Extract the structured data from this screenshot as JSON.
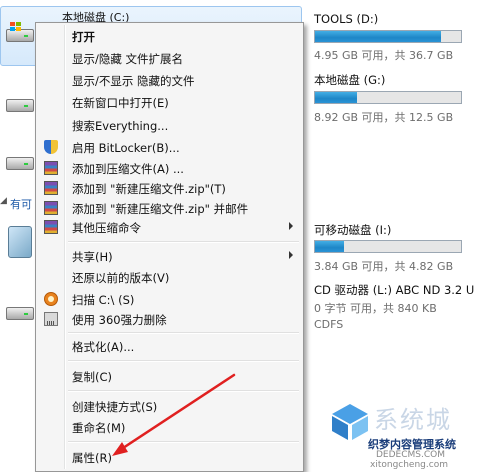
{
  "left_panel": {
    "selected_drive_title": "本地磁盘 (C:)",
    "section_heading": "有可"
  },
  "drives": [
    {
      "name": "TOOLS (D:)",
      "usage_fraction": 0.865,
      "info": "4.95 GB 可用，共 36.7 GB"
    },
    {
      "name": "本地磁盘 (G:)",
      "usage_fraction": 0.29,
      "info": "8.92 GB 可用，共 12.5 GB"
    },
    {
      "name": "可移动磁盘 (I:)",
      "usage_fraction": 0.2,
      "info": "3.84 GB 可用，共 4.82 GB"
    },
    {
      "name": "CD 驱动器 (L:) ABC ND 3.2 U",
      "info": "0 字节 可用，共 840 KB",
      "fs": "CDFS"
    }
  ],
  "context_menu": {
    "items": [
      {
        "label": "打开",
        "bold": true
      },
      {
        "label": "显示/隐藏 文件扩展名"
      },
      {
        "label": "显示/不显示 隐藏的文件"
      },
      {
        "label": "在新窗口中打开(E)"
      },
      {
        "label": "搜索Everything..."
      },
      {
        "label": "启用 BitLocker(B)...",
        "icon": "bitlocker-shield-icon"
      },
      {
        "label": "添加到压缩文件(A) ...",
        "icon": "winrar-icon"
      },
      {
        "label": "添加到 \"新建压缩文件.zip\"(T)",
        "icon": "winrar-icon"
      },
      {
        "label": "添加到 \"新建压缩文件.zip\" 并邮件",
        "icon": "winrar-icon"
      },
      {
        "label": "其他压缩命令",
        "icon": "winrar-icon",
        "submenu": true
      },
      {
        "label": "共享(H)",
        "submenu": true
      },
      {
        "label": "还原以前的版本(V)"
      },
      {
        "label": "扫描 C:\\ (S)",
        "icon": "360-scan-icon"
      },
      {
        "label": "使用 360强力删除",
        "icon": "360-shredder-icon"
      },
      {
        "label": "格式化(A)..."
      },
      {
        "label": "复制(C)"
      },
      {
        "label": "创建快捷方式(S)"
      },
      {
        "label": "重命名(M)"
      },
      {
        "label": "属性(R)"
      }
    ]
  },
  "watermark": {
    "text": "系统城",
    "subtitle": "织梦内容管理系统",
    "url1": "DEDECMS.COM",
    "url2": "xitongcheng.com"
  },
  "colors": {
    "drive_bar_fill": "#1e86c7",
    "menu_background": "#f5f5f5",
    "annotation_arrow": "#e02020",
    "selection_background": "#d6e9fb"
  }
}
